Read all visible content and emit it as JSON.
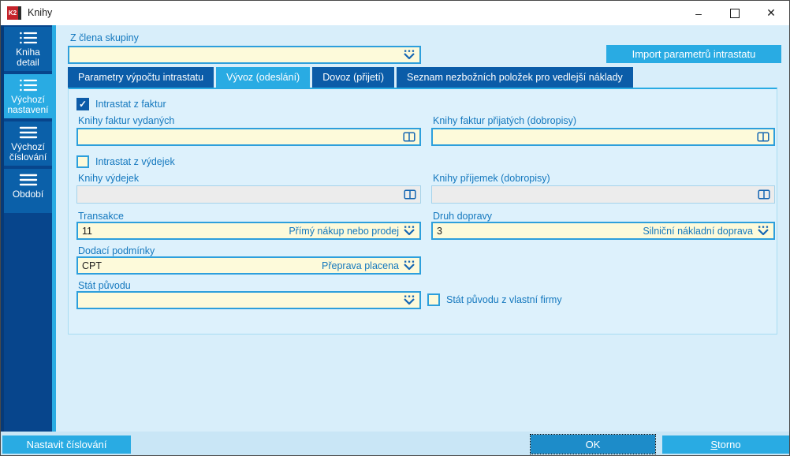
{
  "titlebar": {
    "logo_text": "K2",
    "title": "Knihy",
    "minimize_glyph": "–",
    "close_glyph": "✕"
  },
  "sidebar": {
    "items": [
      {
        "label": "Kniha detail",
        "icon": "list-icon",
        "selected": false
      },
      {
        "label": "Výchozí nastavení",
        "icon": "list-icon",
        "selected": true
      },
      {
        "label": "Výchozí číslování",
        "icon": "menu-icon",
        "selected": false
      },
      {
        "label": "Období",
        "icon": "menu-icon",
        "selected": false
      }
    ]
  },
  "header": {
    "group_field": {
      "label": "Z člena skupiny",
      "value": ""
    },
    "import_button_label": "Import parametrů intrastatu"
  },
  "tabs": [
    {
      "label": "Parametry výpočtu intrastatu",
      "selected": false
    },
    {
      "label": "Vývoz (odeslání)",
      "selected": true
    },
    {
      "label": "Dovoz (přijetí)",
      "selected": false
    },
    {
      "label": "Seznam nezbožních položek pro vedlejší náklady",
      "selected": false
    }
  ],
  "panel": {
    "intrastat_z_faktur": {
      "label": "Intrastat z faktur",
      "checked": true
    },
    "knihy_faktur_vydanych": {
      "label": "Knihy faktur vydaných",
      "value": ""
    },
    "knihy_faktur_prijatych": {
      "label": "Knihy faktur přijatých (dobropisy)",
      "value": ""
    },
    "intrastat_z_vydejek": {
      "label": "Intrastat z výdejek",
      "checked": false
    },
    "knihy_vydejek": {
      "label": "Knihy výdejek",
      "value": "",
      "disabled": true
    },
    "knihy_prijemek": {
      "label": "Knihy příjemek (dobropisy)",
      "value": "",
      "disabled": true
    },
    "transakce": {
      "label": "Transakce",
      "code": "11",
      "description": "Přímý nákup nebo prodej"
    },
    "druh_dopravy": {
      "label": "Druh dopravy",
      "code": "3",
      "description": "Silniční nákladní doprava"
    },
    "dodaci_podminky": {
      "label": "Dodací podmínky",
      "code": "CPT",
      "description": "Přeprava placena"
    },
    "stat_puvodu": {
      "label": "Stát původu",
      "code": "",
      "description": ""
    },
    "stat_puvodu_z_vlastni_firmy": {
      "label": "Stát původu z vlastní firmy",
      "checked": false
    }
  },
  "footer": {
    "nastavit_cislovani_label": "Nastavit číslování",
    "ok_label": "OK",
    "storno_accel": "S",
    "storno_rest": "torno"
  },
  "icons": {
    "check_glyph": "✓"
  },
  "colors": {
    "accent_cyan": "#29abe3",
    "dark_blue": "#0b5ca8",
    "sidebar_blue": "#07458c",
    "input_yellow": "#fdfada",
    "input_border": "#2d9fdc",
    "label_blue": "#1478be",
    "logo_red": "#c4232b",
    "ok_button": "#1d8cc9"
  }
}
